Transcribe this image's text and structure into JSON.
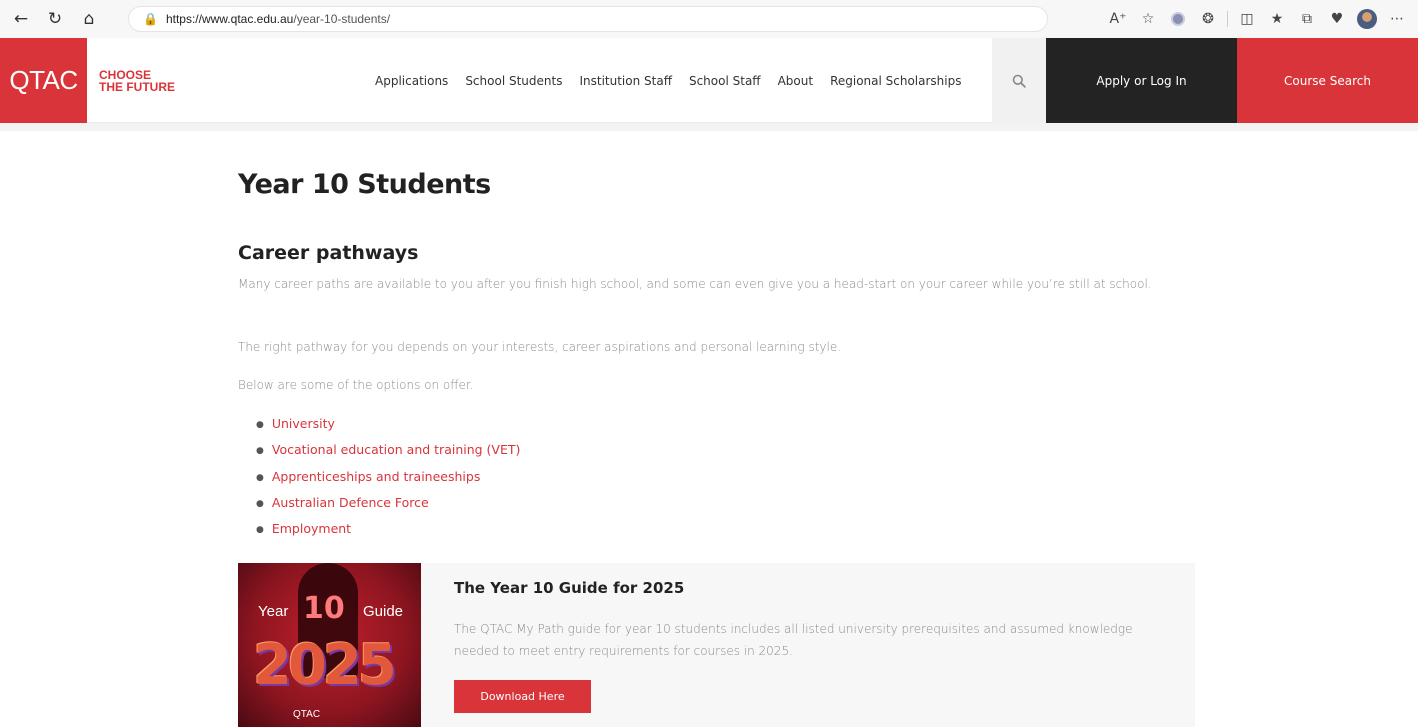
{
  "browser": {
    "back_icon": "arrow-left-icon",
    "refresh_icon": "refresh-icon",
    "home_icon": "home-icon",
    "url_domain": "https://www.qtac.edu.au",
    "url_path": "/year-10-students/",
    "toolbar_icons": [
      "read-aloud-icon",
      "favorite-star-icon",
      "extension-icon",
      "extensions-icon",
      "split-screen-icon",
      "favorites-icon",
      "collections-icon",
      "performance-icon",
      "profile-avatar",
      "more-icon"
    ]
  },
  "header": {
    "logo_text": "QTAC",
    "tagline_line1": "CHOOSE",
    "tagline_line2": "THE FUTURE",
    "nav": [
      "Applications",
      "School Students",
      "Institution Staff",
      "School Staff",
      "About",
      "Regional Scholarships"
    ],
    "apply_label": "Apply or Log In",
    "course_search_label": "Course Search",
    "brand_color": "#d9343a",
    "dark_color": "#232323"
  },
  "main": {
    "page_title": "Year 10 Students",
    "section_title": "Career pathways",
    "para1": "Many career paths are available to you after you finish high school, and some can even give you a head-start on your career while you’re still at school.",
    "para2": "The right pathway for you depends on your interests, career aspirations and personal learning style.",
    "para3": "Below are some of the options on offer.",
    "links": [
      "University",
      "Vocational education and training (VET)",
      "Apprenticeships and traineeships",
      "Australian Defence Force",
      "Employment"
    ]
  },
  "guide": {
    "cover_year": "Year",
    "cover_10": "10",
    "cover_guide": "Guide",
    "cover_2025": "2025",
    "cover_brand": "QTAC",
    "title": "The Year 10 Guide for 2025",
    "description": "The QTAC My Path guide for year 10 students includes all listed university prerequisites and assumed knowledge needed to meet entry requirements for courses in 2025.",
    "button_label": "Download Here"
  }
}
